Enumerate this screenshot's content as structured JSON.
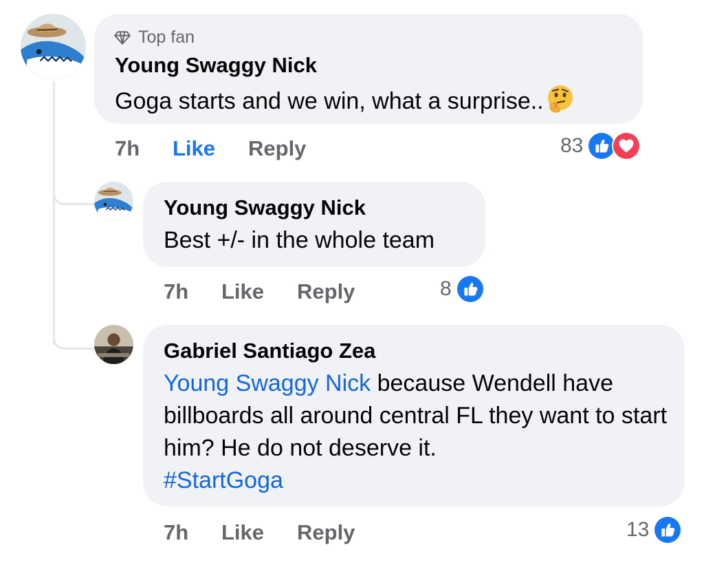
{
  "colors": {
    "link": "#1467d8",
    "like_blue": "#1877f2",
    "love_red": "#f33e58",
    "bubble": "#f0f2f5",
    "muted": "#65676b"
  },
  "comments": [
    {
      "badge": "Top fan",
      "badge_icon": "diamond-icon",
      "author": "Young Swaggy Nick",
      "text": "Goga starts and we win, what a surprise..",
      "emoji": "thinking-face-icon",
      "time": "7h",
      "like_label": "Like",
      "reply_label": "Reply",
      "reaction_count": "83",
      "reactions": [
        "like-reaction-icon",
        "love-reaction-icon"
      ],
      "liked": true
    },
    {
      "author": "Young Swaggy Nick",
      "text": "Best +/- in the whole team",
      "time": "7h",
      "like_label": "Like",
      "reply_label": "Reply",
      "reaction_count": "8",
      "reactions": [
        "like-reaction-icon"
      ]
    },
    {
      "author": "Gabriel Santiago Zea",
      "mention": "Young Swaggy Nick",
      "text_line1": "because Wendell have",
      "text_rest": "billboards all around central FL they want to start him? He do not deserve it.",
      "hashtag": "#StartGoga",
      "time": "7h",
      "like_label": "Like",
      "reply_label": "Reply",
      "reaction_count": "13",
      "reactions": [
        "like-reaction-icon"
      ]
    }
  ]
}
